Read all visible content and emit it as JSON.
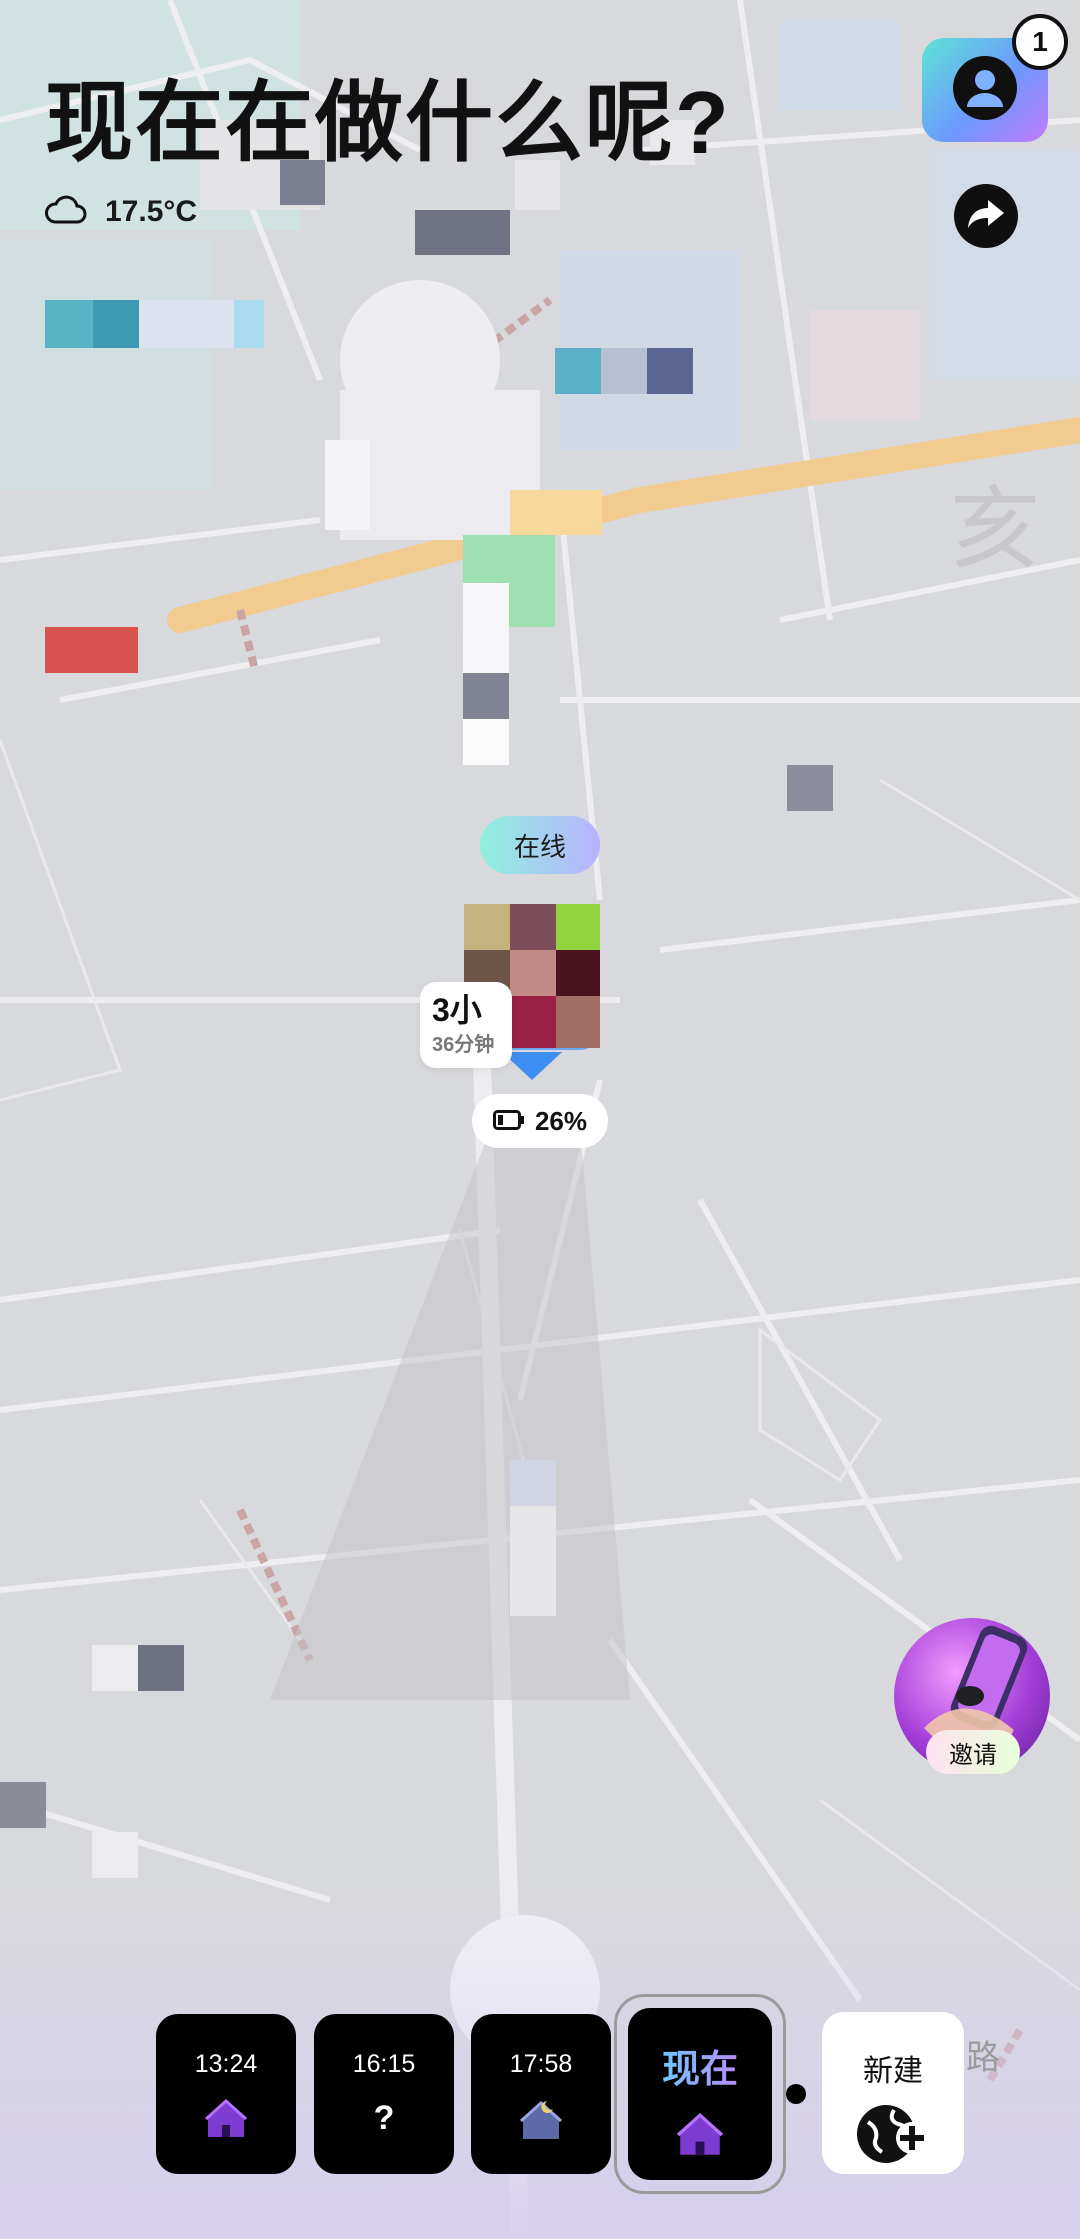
{
  "header": {
    "title": "现在在做什么呢?"
  },
  "weather": {
    "icon": "cloud-icon",
    "temperature": "17.5°C"
  },
  "notifications": {
    "count": "1"
  },
  "profile": {
    "icon": "user-icon"
  },
  "share": {
    "icon": "share-arrow-icon"
  },
  "map": {
    "road_label": "路",
    "status_pill": "在线",
    "duration_main": "3小",
    "duration_sub": "36分钟",
    "battery_percent": "26%"
  },
  "invite": {
    "label": "邀请"
  },
  "timeline": {
    "items": [
      {
        "time": "13:24",
        "icon": "house-icon"
      },
      {
        "time": "16:15",
        "icon": "question-icon",
        "symbol": "?"
      },
      {
        "time": "17:58",
        "icon": "house-night-icon"
      }
    ],
    "current": {
      "label": "现在",
      "icon": "house-icon"
    },
    "new": {
      "label": "新建",
      "icon": "globe-plus-icon"
    }
  },
  "colors": {
    "map_bg": "#d9dadd",
    "road_main": "#f2c98a",
    "accent_gradient_start": "#5fe3d4",
    "accent_gradient_end": "#c27bff",
    "tile_bg": "#000000"
  }
}
